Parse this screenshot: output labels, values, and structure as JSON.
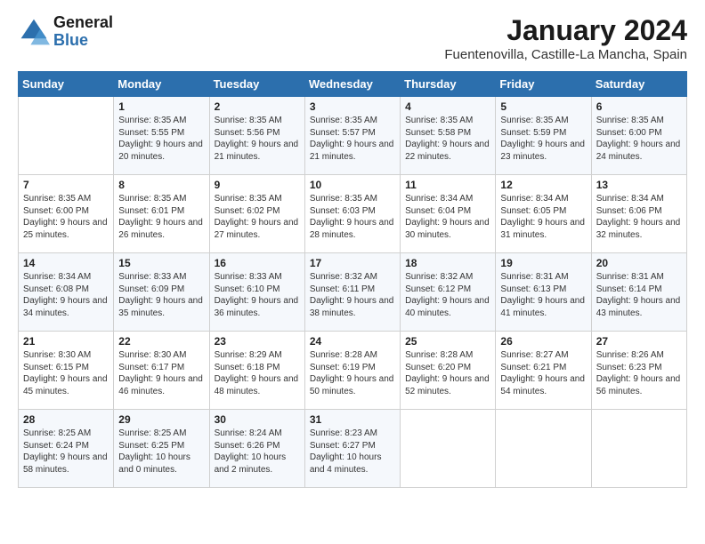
{
  "logo": {
    "line1": "General",
    "line2": "Blue"
  },
  "title": "January 2024",
  "location": "Fuentenovilla, Castille-La Mancha, Spain",
  "days_of_week": [
    "Sunday",
    "Monday",
    "Tuesday",
    "Wednesday",
    "Thursday",
    "Friday",
    "Saturday"
  ],
  "weeks": [
    [
      {
        "day": "",
        "sunrise": "",
        "sunset": "",
        "daylight": ""
      },
      {
        "day": "1",
        "sunrise": "Sunrise: 8:35 AM",
        "sunset": "Sunset: 5:55 PM",
        "daylight": "Daylight: 9 hours and 20 minutes."
      },
      {
        "day": "2",
        "sunrise": "Sunrise: 8:35 AM",
        "sunset": "Sunset: 5:56 PM",
        "daylight": "Daylight: 9 hours and 21 minutes."
      },
      {
        "day": "3",
        "sunrise": "Sunrise: 8:35 AM",
        "sunset": "Sunset: 5:57 PM",
        "daylight": "Daylight: 9 hours and 21 minutes."
      },
      {
        "day": "4",
        "sunrise": "Sunrise: 8:35 AM",
        "sunset": "Sunset: 5:58 PM",
        "daylight": "Daylight: 9 hours and 22 minutes."
      },
      {
        "day": "5",
        "sunrise": "Sunrise: 8:35 AM",
        "sunset": "Sunset: 5:59 PM",
        "daylight": "Daylight: 9 hours and 23 minutes."
      },
      {
        "day": "6",
        "sunrise": "Sunrise: 8:35 AM",
        "sunset": "Sunset: 6:00 PM",
        "daylight": "Daylight: 9 hours and 24 minutes."
      }
    ],
    [
      {
        "day": "7",
        "sunrise": "Sunrise: 8:35 AM",
        "sunset": "Sunset: 6:00 PM",
        "daylight": "Daylight: 9 hours and 25 minutes."
      },
      {
        "day": "8",
        "sunrise": "Sunrise: 8:35 AM",
        "sunset": "Sunset: 6:01 PM",
        "daylight": "Daylight: 9 hours and 26 minutes."
      },
      {
        "day": "9",
        "sunrise": "Sunrise: 8:35 AM",
        "sunset": "Sunset: 6:02 PM",
        "daylight": "Daylight: 9 hours and 27 minutes."
      },
      {
        "day": "10",
        "sunrise": "Sunrise: 8:35 AM",
        "sunset": "Sunset: 6:03 PM",
        "daylight": "Daylight: 9 hours and 28 minutes."
      },
      {
        "day": "11",
        "sunrise": "Sunrise: 8:34 AM",
        "sunset": "Sunset: 6:04 PM",
        "daylight": "Daylight: 9 hours and 30 minutes."
      },
      {
        "day": "12",
        "sunrise": "Sunrise: 8:34 AM",
        "sunset": "Sunset: 6:05 PM",
        "daylight": "Daylight: 9 hours and 31 minutes."
      },
      {
        "day": "13",
        "sunrise": "Sunrise: 8:34 AM",
        "sunset": "Sunset: 6:06 PM",
        "daylight": "Daylight: 9 hours and 32 minutes."
      }
    ],
    [
      {
        "day": "14",
        "sunrise": "Sunrise: 8:34 AM",
        "sunset": "Sunset: 6:08 PM",
        "daylight": "Daylight: 9 hours and 34 minutes."
      },
      {
        "day": "15",
        "sunrise": "Sunrise: 8:33 AM",
        "sunset": "Sunset: 6:09 PM",
        "daylight": "Daylight: 9 hours and 35 minutes."
      },
      {
        "day": "16",
        "sunrise": "Sunrise: 8:33 AM",
        "sunset": "Sunset: 6:10 PM",
        "daylight": "Daylight: 9 hours and 36 minutes."
      },
      {
        "day": "17",
        "sunrise": "Sunrise: 8:32 AM",
        "sunset": "Sunset: 6:11 PM",
        "daylight": "Daylight: 9 hours and 38 minutes."
      },
      {
        "day": "18",
        "sunrise": "Sunrise: 8:32 AM",
        "sunset": "Sunset: 6:12 PM",
        "daylight": "Daylight: 9 hours and 40 minutes."
      },
      {
        "day": "19",
        "sunrise": "Sunrise: 8:31 AM",
        "sunset": "Sunset: 6:13 PM",
        "daylight": "Daylight: 9 hours and 41 minutes."
      },
      {
        "day": "20",
        "sunrise": "Sunrise: 8:31 AM",
        "sunset": "Sunset: 6:14 PM",
        "daylight": "Daylight: 9 hours and 43 minutes."
      }
    ],
    [
      {
        "day": "21",
        "sunrise": "Sunrise: 8:30 AM",
        "sunset": "Sunset: 6:15 PM",
        "daylight": "Daylight: 9 hours and 45 minutes."
      },
      {
        "day": "22",
        "sunrise": "Sunrise: 8:30 AM",
        "sunset": "Sunset: 6:17 PM",
        "daylight": "Daylight: 9 hours and 46 minutes."
      },
      {
        "day": "23",
        "sunrise": "Sunrise: 8:29 AM",
        "sunset": "Sunset: 6:18 PM",
        "daylight": "Daylight: 9 hours and 48 minutes."
      },
      {
        "day": "24",
        "sunrise": "Sunrise: 8:28 AM",
        "sunset": "Sunset: 6:19 PM",
        "daylight": "Daylight: 9 hours and 50 minutes."
      },
      {
        "day": "25",
        "sunrise": "Sunrise: 8:28 AM",
        "sunset": "Sunset: 6:20 PM",
        "daylight": "Daylight: 9 hours and 52 minutes."
      },
      {
        "day": "26",
        "sunrise": "Sunrise: 8:27 AM",
        "sunset": "Sunset: 6:21 PM",
        "daylight": "Daylight: 9 hours and 54 minutes."
      },
      {
        "day": "27",
        "sunrise": "Sunrise: 8:26 AM",
        "sunset": "Sunset: 6:23 PM",
        "daylight": "Daylight: 9 hours and 56 minutes."
      }
    ],
    [
      {
        "day": "28",
        "sunrise": "Sunrise: 8:25 AM",
        "sunset": "Sunset: 6:24 PM",
        "daylight": "Daylight: 9 hours and 58 minutes."
      },
      {
        "day": "29",
        "sunrise": "Sunrise: 8:25 AM",
        "sunset": "Sunset: 6:25 PM",
        "daylight": "Daylight: 10 hours and 0 minutes."
      },
      {
        "day": "30",
        "sunrise": "Sunrise: 8:24 AM",
        "sunset": "Sunset: 6:26 PM",
        "daylight": "Daylight: 10 hours and 2 minutes."
      },
      {
        "day": "31",
        "sunrise": "Sunrise: 8:23 AM",
        "sunset": "Sunset: 6:27 PM",
        "daylight": "Daylight: 10 hours and 4 minutes."
      },
      {
        "day": "",
        "sunrise": "",
        "sunset": "",
        "daylight": ""
      },
      {
        "day": "",
        "sunrise": "",
        "sunset": "",
        "daylight": ""
      },
      {
        "day": "",
        "sunrise": "",
        "sunset": "",
        "daylight": ""
      }
    ]
  ]
}
